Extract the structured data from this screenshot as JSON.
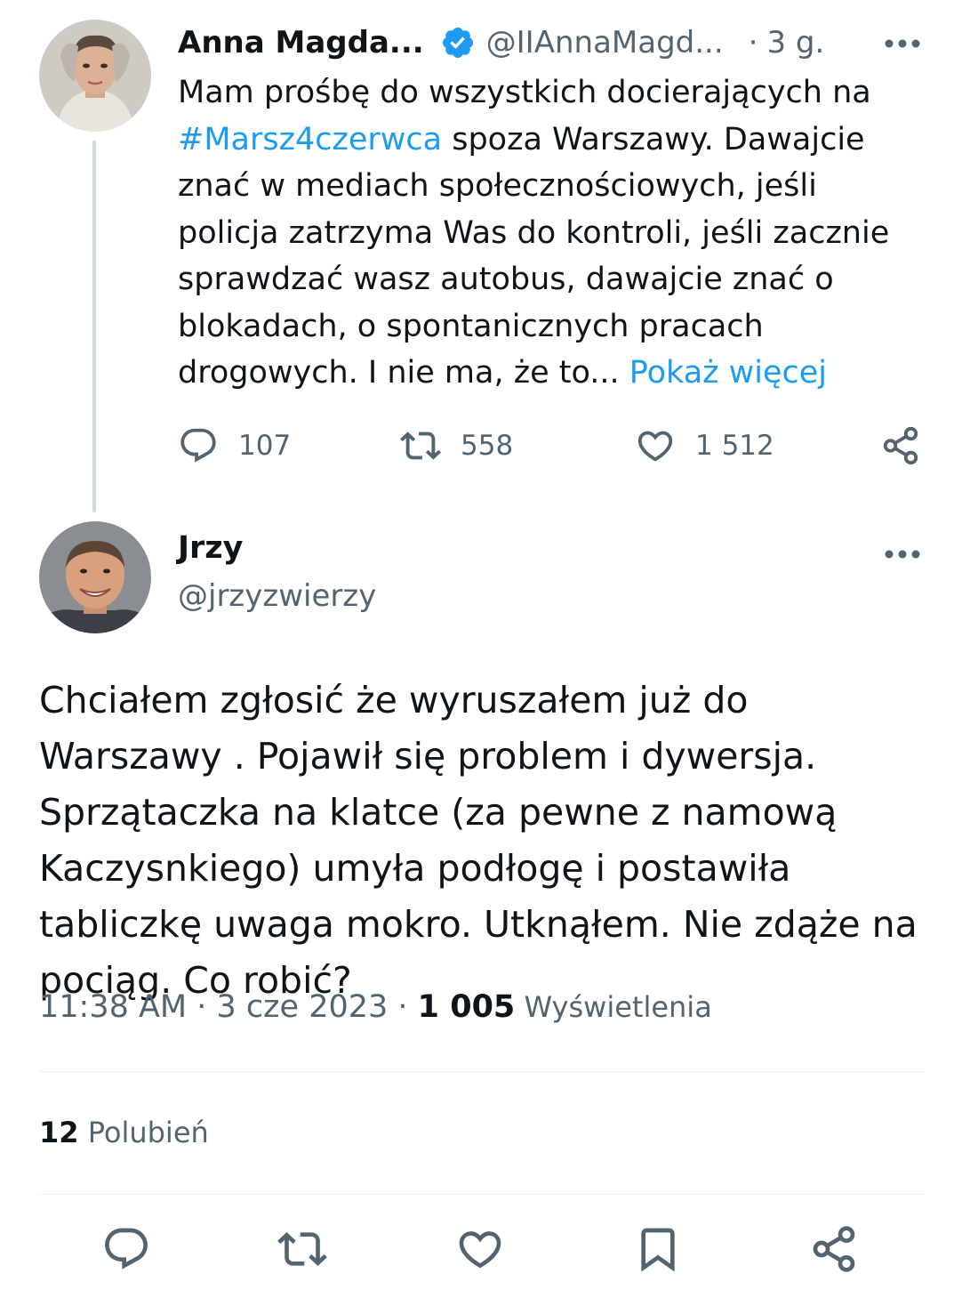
{
  "parent_tweet": {
    "author_name": "Anna Magda...",
    "handle": "@IIAnnaMagd...",
    "dot": "·",
    "time": "3 g.",
    "text_intro": "Mam prośbę do wszystkich docierających na ",
    "hashtag": "#Marsz4czerwca",
    "text_body": " spoza Warszawy. Dawajcie znać w mediach społecznościowych, jeśli policja zatrzyma Was do kontroli, jeśli zacznie sprawdzać wasz autobus, dawajcie znać o blokadach, o spontanicznych pracach drogowych.  I nie ma, że to... ",
    "show_more": "Pokaż więcej",
    "replies": "107",
    "retweets": "558",
    "likes": "1 512",
    "verified_color": "#1d9bf0",
    "icons": {
      "verified": "verified-badge-icon",
      "more": "more-horizontal-icon",
      "reply": "reply-icon",
      "retweet": "retweet-icon",
      "like": "heart-icon",
      "share": "share-icon"
    }
  },
  "reply_tweet": {
    "author_name": "Jrzy",
    "handle": "@jrzyzwierzy",
    "text": "Chciałem zgłosić że wyruszałem już do Warszawy . Pojawił się problem i dywersja. Sprzątaczka na klatce (za pewne z namową Kaczysnkiego) umyła podłogę i postawiła tabliczkę uwaga mokro. Utknąłem. Nie zdąże na pociąg. Co robić?",
    "time": "11:38 AM",
    "sep": " · ",
    "date": "3 cze 2023",
    "views_count": "1 005",
    "views_label": " Wyświetlenia",
    "likes_count": "12",
    "likes_label": " Polubień",
    "icons": {
      "reply": "reply-icon",
      "retweet": "retweet-icon",
      "like": "heart-icon",
      "bookmark": "bookmark-icon",
      "share": "share-icon"
    }
  },
  "colors": {
    "link": "#1d9bf0",
    "secondary_text": "#536471",
    "primary_text": "#0f1419",
    "divider": "#eff3f4",
    "thread_line": "#cfd9de"
  }
}
